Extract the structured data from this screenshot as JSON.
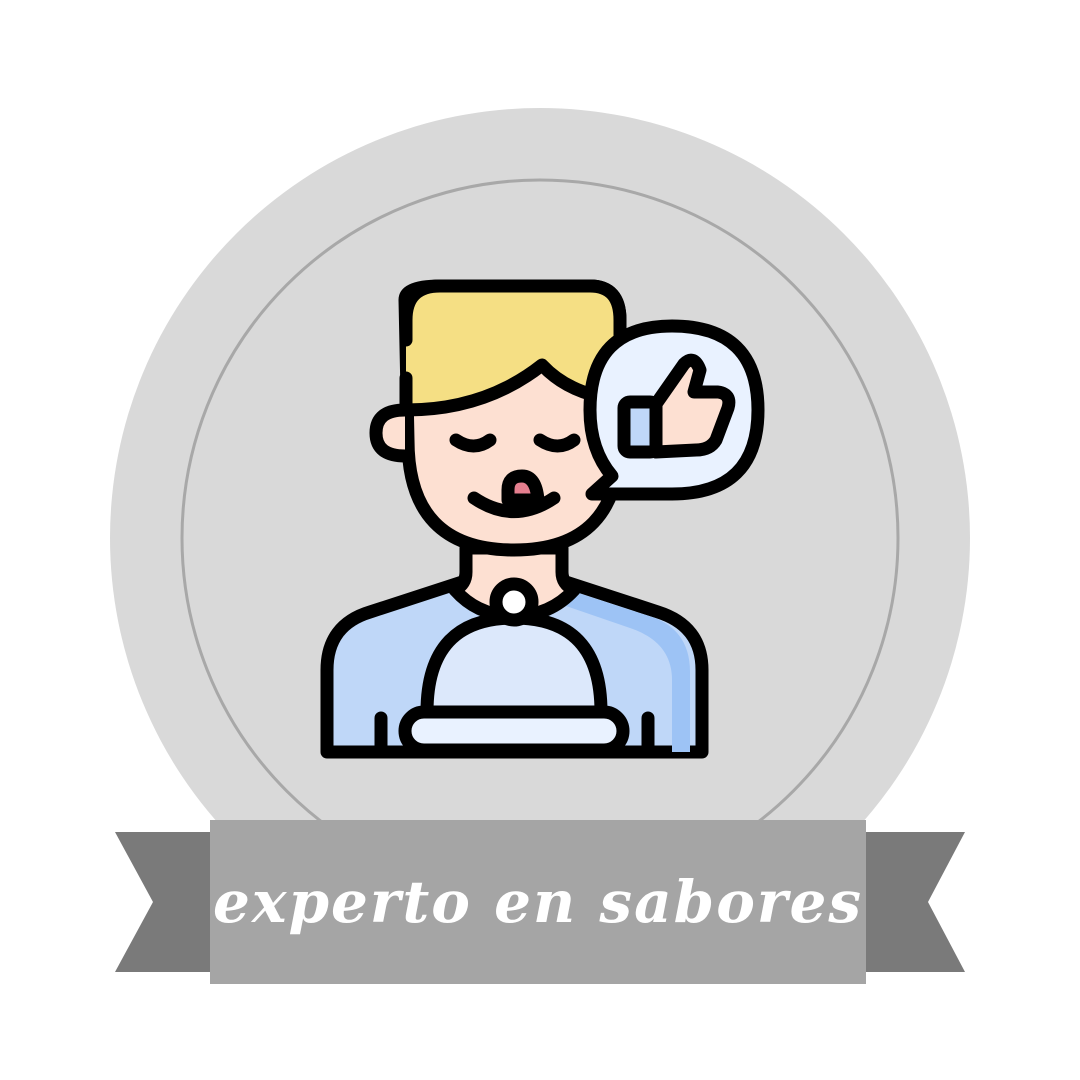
{
  "badge": {
    "label": "experto en sabores",
    "icon": "chef-tasting-thumbs-up-icon"
  },
  "colors": {
    "background": "#ffffff",
    "badge_outer": "#d9d9d9",
    "badge_ring": "#a8a8a8",
    "ribbon_main": "#a5a5a5",
    "ribbon_tail": "#7a7a7a",
    "hair": "#f5df84",
    "skin": "#fde0d2",
    "shirt": "#bfd7f8",
    "cloche": "#dce8fb",
    "bubble": "#e9f2ff",
    "outline": "#000000",
    "text": "#ffffff"
  }
}
